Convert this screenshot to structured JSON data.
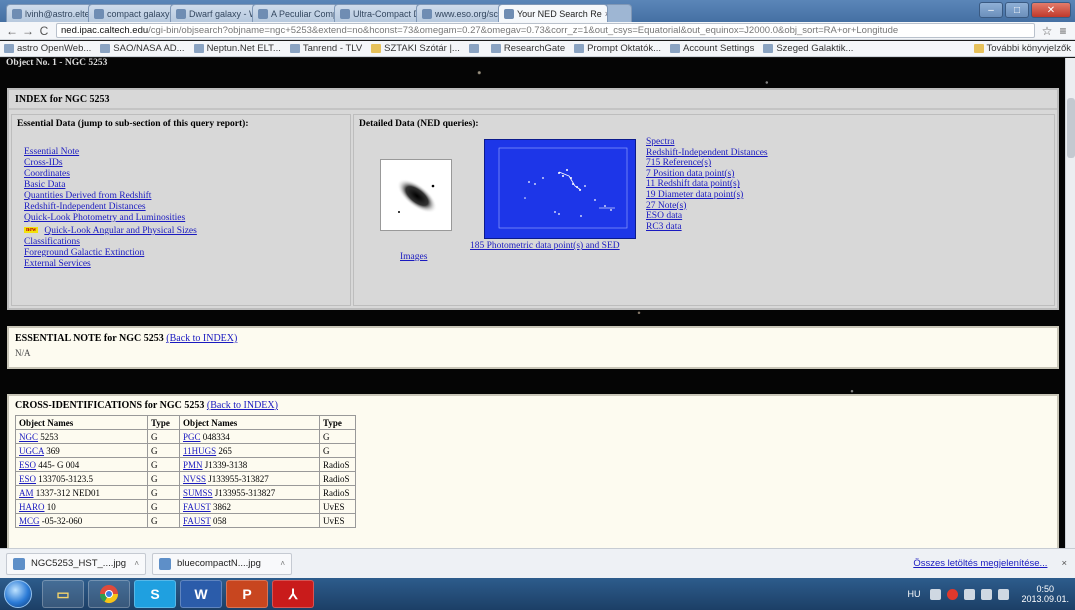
{
  "browser": {
    "tabs": [
      {
        "label": "lvinh@astro.elte.hu"
      },
      {
        "label": "compact galaxy pdf"
      },
      {
        "label": "Dwarf galaxy - Wiki"
      },
      {
        "label": "A Peculiar Compact"
      },
      {
        "label": "Ultra-Compact Dwa"
      },
      {
        "label": "www.eso.org/sci/pu"
      },
      {
        "label": "Your NED Search Re",
        "active": true
      }
    ],
    "url_host": "ned.ipac.caltech.edu",
    "url_path": "/cgi-bin/objsearch?objname=ngc+5253&extend=no&hconst=73&omegam=0.27&omegav=0.73&corr_z=1&out_csys=Equatorial&out_equinox=J2000.0&obj_sort=RA+or+Longitude",
    "bookmarks": [
      {
        "label": "astro OpenWeb..."
      },
      {
        "label": "SAO/NASA AD..."
      },
      {
        "label": "Neptun.Net ELT..."
      },
      {
        "label": "Tanrend - TLV"
      },
      {
        "label": "SZTAKI Szótár |..."
      },
      {
        "label": ""
      },
      {
        "label": "ResearchGate"
      },
      {
        "label": "Prompt Oktatók..."
      },
      {
        "label": "Account Settings"
      },
      {
        "label": "Szeged Galaktik..."
      }
    ],
    "bookmarks_other": "További könyvjelzők"
  },
  "page": {
    "object_header": "Object No. 1 - NGC 5253",
    "index_title": "INDEX for NGC 5253",
    "essential_heading": "Essential Data (jump to sub-section of this query report):",
    "essential_links": [
      "Essential Note",
      "Cross-IDs",
      "Coordinates",
      "Basic Data",
      "Quantities Derived from Redshift",
      "Redshift-Independent Distances",
      "Quick-Look Photometry and Luminosities",
      "Quick-Look Angular and Physical Sizes",
      "Classifications",
      "Foreground Galactic Extinction",
      "External Services"
    ],
    "new_badge": "new",
    "detailed_heading": "Detailed Data (NED queries):",
    "images_link": "Images",
    "photometric_link": "185 Photometric data point(s) and SED",
    "detailed_links": [
      "Spectra",
      "Redshift-Independent Distances",
      "715 Reference(s)",
      "7 Position data point(s)",
      "11 Redshift data point(s)",
      "19 Diameter data point(s)",
      "27 Note(s)",
      "ESO data",
      "RC3 data"
    ],
    "essential_note_title": "ESSENTIAL NOTE for NGC 5253",
    "back_to_index": "(Back to INDEX)",
    "essential_note_value": "N/A",
    "cross_title": "CROSS-IDENTIFICATIONS for NGC 5253",
    "cross_headers": [
      "Object Names",
      "Type",
      "Object Names",
      "Type"
    ],
    "cross_rows": [
      {
        "a_cat": "NGC",
        "a_num": " 5253",
        "a_type": "G",
        "b_cat": "PGC",
        "b_num": " 048334",
        "b_type": "G"
      },
      {
        "a_cat": "UGCA",
        "a_num": " 369",
        "a_type": "G",
        "b_cat": "11HUGS",
        "b_num": " 265",
        "b_type": "G"
      },
      {
        "a_cat": "ESO",
        "a_num": " 445- G 004",
        "a_type": "G",
        "b_cat": "PMN",
        "b_num": " J1339-3138",
        "b_type": "RadioS"
      },
      {
        "a_cat": "ESO",
        "a_num": " 133705-3123.5",
        "a_type": "G",
        "b_cat": "NVSS",
        "b_num": " J133955-313827",
        "b_type": "RadioS"
      },
      {
        "a_cat": "AM",
        "a_num": " 1337-312 NED01",
        "a_type": "G",
        "b_cat": "SUMSS",
        "b_num": " J133955-313827",
        "b_type": "RadioS"
      },
      {
        "a_cat": "HARO",
        "a_num": " 10",
        "a_type": "G",
        "b_cat": "FAUST",
        "b_num": " 3862",
        "b_type": "UvES"
      },
      {
        "a_cat": "MCG",
        "a_num": " -05-32-060",
        "a_type": "G",
        "b_cat": "FAUST",
        "b_num": " 058",
        "b_type": "UvES"
      }
    ]
  },
  "downloads": {
    "items": [
      "NGC5253_HST_....jpg",
      "bluecompactN....jpg"
    ],
    "show_all": "Összes letöltés megjelenítése..."
  },
  "taskbar": {
    "lang": "HU",
    "time": "0:50",
    "date": "2013.09.01."
  }
}
